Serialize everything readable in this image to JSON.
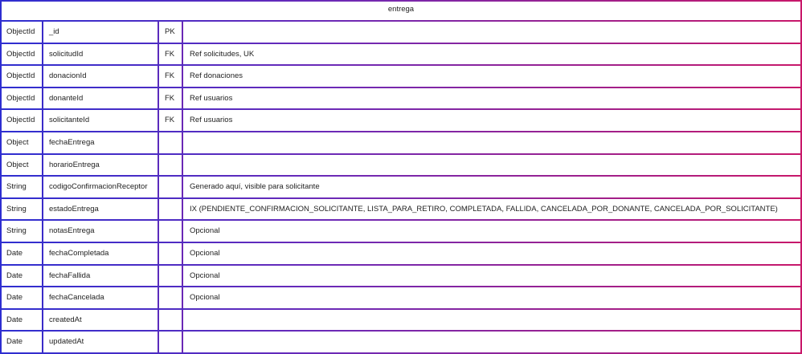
{
  "entity": {
    "title": "entrega",
    "rows": [
      {
        "type": "ObjectId",
        "name": "_id",
        "key": "PK",
        "desc": ""
      },
      {
        "type": "ObjectId",
        "name": "solicitudId",
        "key": "FK",
        "desc": "Ref solicitudes, UK"
      },
      {
        "type": "ObjectId",
        "name": "donacionId",
        "key": "FK",
        "desc": "Ref donaciones"
      },
      {
        "type": "ObjectId",
        "name": "donanteId",
        "key": "FK",
        "desc": "Ref usuarios"
      },
      {
        "type": "ObjectId",
        "name": "solicitanteId",
        "key": "FK",
        "desc": "Ref usuarios"
      },
      {
        "type": "Object",
        "name": "fechaEntrega",
        "key": "",
        "desc": ""
      },
      {
        "type": "Object",
        "name": "horarioEntrega",
        "key": "",
        "desc": ""
      },
      {
        "type": "String",
        "name": "codigoConfirmacionReceptor",
        "key": "",
        "desc": "Generado aquí, visible para solicitante"
      },
      {
        "type": "String",
        "name": "estadoEntrega",
        "key": "",
        "desc": "IX (PENDIENTE_CONFIRMACION_SOLICITANTE, LISTA_PARA_RETIRO, COMPLETADA, FALLIDA, CANCELADA_POR_DONANTE, CANCELADA_POR_SOLICITANTE)"
      },
      {
        "type": "String",
        "name": "notasEntrega",
        "key": "",
        "desc": "Opcional"
      },
      {
        "type": "Date",
        "name": "fechaCompletada",
        "key": "",
        "desc": "Opcional"
      },
      {
        "type": "Date",
        "name": "fechaFallida",
        "key": "",
        "desc": "Opcional"
      },
      {
        "type": "Date",
        "name": "fechaCancelada",
        "key": "",
        "desc": "Opcional"
      },
      {
        "type": "Date",
        "name": "createdAt",
        "key": "",
        "desc": ""
      },
      {
        "type": "Date",
        "name": "updatedAt",
        "key": "",
        "desc": ""
      }
    ]
  }
}
